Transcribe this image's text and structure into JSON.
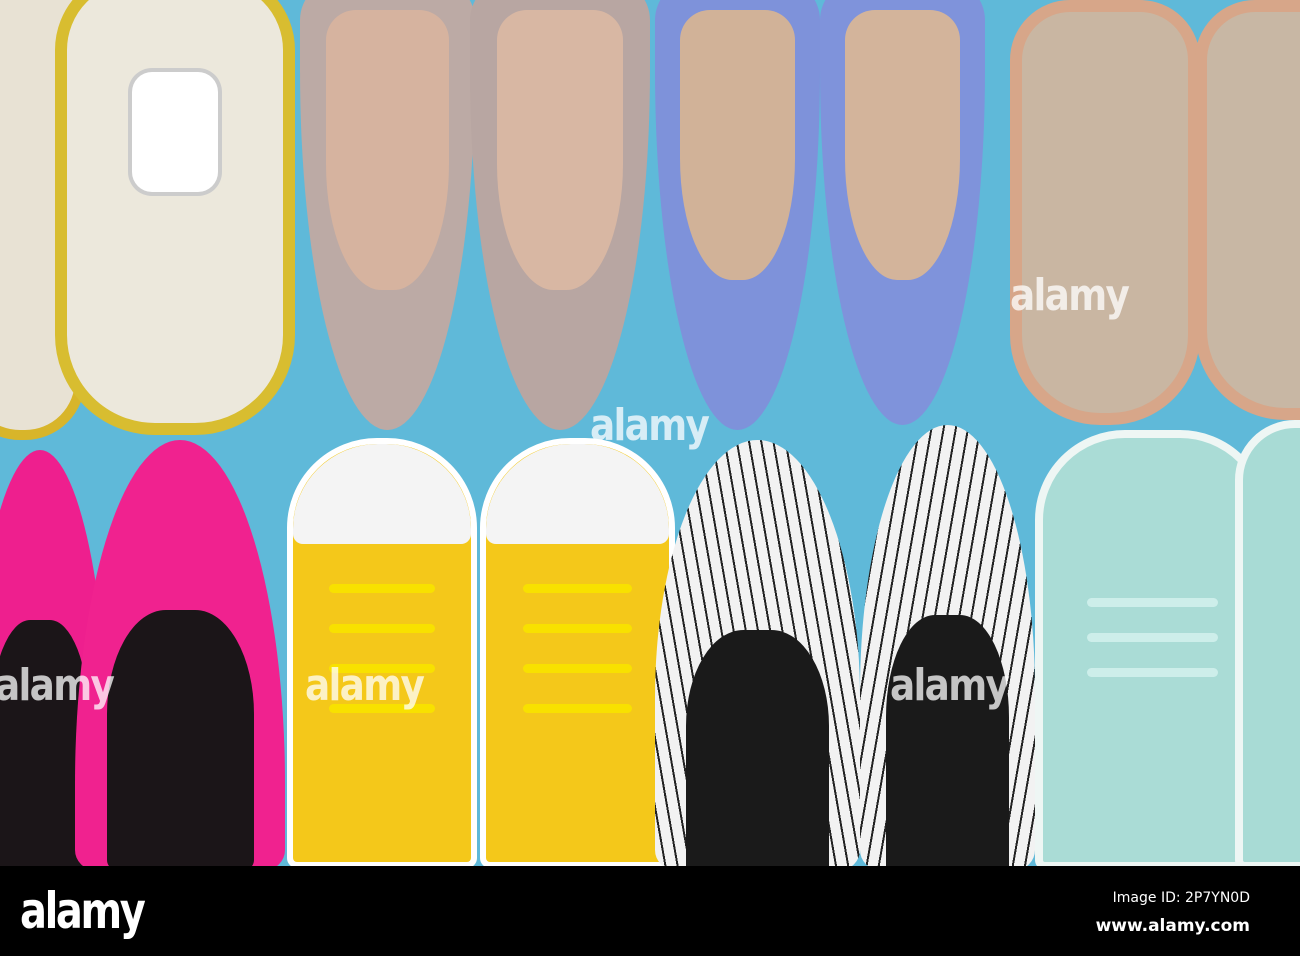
{
  "colors": {
    "background": "#5fb9d9",
    "sneaker": "#ece7dc",
    "glitter": "#b9a8a3",
    "blue_heel": "#7f93d9",
    "sandal": "#d9a88c",
    "pink": "#f0208f",
    "yellow": "#f4c91a",
    "stripe": "#f1f1f1",
    "mint": "#a9dcd6"
  },
  "watermark": "alamy",
  "footer": {
    "logo": "alamy",
    "image_id": "Image ID: 2P7YN0D",
    "url": "www.alamy.com"
  }
}
